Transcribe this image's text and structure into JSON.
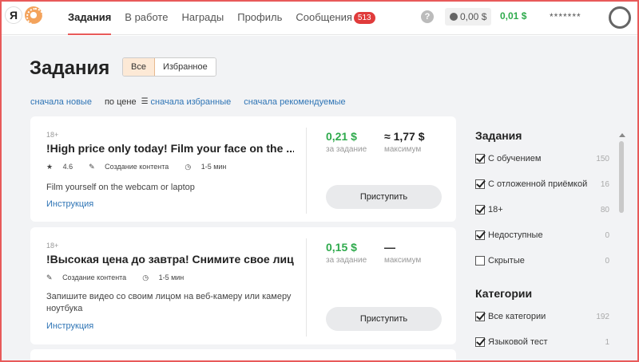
{
  "header": {
    "nav": [
      {
        "label": "Задания",
        "active": true
      },
      {
        "label": "В работе"
      },
      {
        "label": "Награды"
      },
      {
        "label": "Профиль"
      },
      {
        "label": "Сообщения",
        "badge": "513"
      }
    ],
    "help": "?",
    "balance": "0,00 $",
    "earned": "0,01 $",
    "user": "*******"
  },
  "main": {
    "title": "Задания",
    "tabs": [
      "Все",
      "Избранное"
    ],
    "sorts": [
      "сначала новые",
      "по цене",
      "сначала избранные",
      "сначала рекомендуемые"
    ]
  },
  "tasks": [
    {
      "age": "18+",
      "title": "!High price only today! Film your face on the ...",
      "rating": "4.6",
      "category": "Создание контента",
      "duration": "1-5 мин",
      "description": "Film yourself on the webcam or laptop",
      "instruction": "Инструкция",
      "price": "0,21 $",
      "price_label": "за задание",
      "max": "≈ 1,77 $",
      "max_label": "максимум",
      "button": "Приступить"
    },
    {
      "age": "18+",
      "title": "!Высокая цена до завтра! Снимите свое лиц...",
      "category": "Создание контента",
      "duration": "1-5 мин",
      "description": "Запишите видео со своим лицом на веб-камеру или камеру ноутбука",
      "instruction": "Инструкция",
      "price": "0,15 $",
      "price_label": "за задание",
      "max": "—",
      "max_label": "максимум",
      "button": "Приступить"
    }
  ],
  "sidebar": {
    "tasks_title": "Задания",
    "task_filters": [
      {
        "label": "С обучением",
        "count": "150",
        "checked": true
      },
      {
        "label": "С отложенной приёмкой",
        "count": "16",
        "checked": true
      },
      {
        "label": "18+",
        "count": "80",
        "checked": true
      },
      {
        "label": "Недоступные",
        "count": "0",
        "checked": true
      },
      {
        "label": "Скрытые",
        "count": "0",
        "checked": false
      }
    ],
    "categories_title": "Категории",
    "categories": [
      {
        "label": "Все категории",
        "count": "192",
        "checked": true
      },
      {
        "label": "Языковой тест",
        "count": "1",
        "checked": true
      }
    ]
  },
  "colors": {
    "accent": "#e85a5a",
    "green": "#2eaa4c",
    "link": "#2e74b5"
  }
}
